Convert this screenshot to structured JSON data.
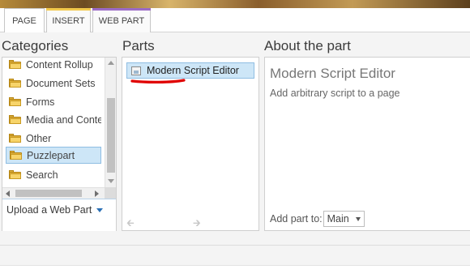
{
  "ribbon": {
    "tabs": [
      {
        "label": "PAGE",
        "color": "#e0e0e0"
      },
      {
        "label": "INSERT",
        "color": "#f2c94c"
      },
      {
        "label": "WEB PART",
        "color": "#9b6bc6"
      }
    ]
  },
  "categories": {
    "title": "Categories",
    "items": [
      {
        "label": "Content Rollup",
        "icon": "folder-icon"
      },
      {
        "label": "Document Sets",
        "icon": "folder-icon"
      },
      {
        "label": "Forms",
        "icon": "folder-icon"
      },
      {
        "label": "Media and Content",
        "icon": "folder-icon"
      },
      {
        "label": "Other",
        "icon": "folder-icon"
      },
      {
        "label": "Puzzlepart",
        "icon": "folder-icon",
        "selected": true
      },
      {
        "label": "Search",
        "icon": "folder-icon"
      }
    ],
    "upload_label": "Upload a Web Part"
  },
  "parts": {
    "title": "Parts",
    "items": [
      {
        "label": "Modern Script Editor",
        "icon": "webpart-icon",
        "selected": true
      }
    ],
    "annotation_color": "#e00000"
  },
  "about": {
    "title": "About the part",
    "part_name": "Modern Script Editor",
    "description": "Add arbitrary script to a page",
    "add_part_to_label": "Add part to:",
    "zone_value": "Main"
  },
  "colors": {
    "selection_bg": "#cde6f7",
    "selection_border": "#8fbde2",
    "link_blue": "#2a6fb5"
  }
}
